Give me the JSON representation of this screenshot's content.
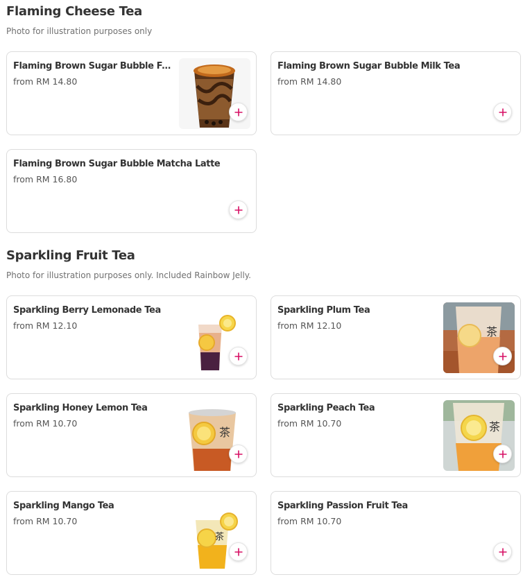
{
  "colors": {
    "accent": "#d70f64",
    "border": "#dcdcdc",
    "text": "#333333",
    "muted": "#707070"
  },
  "sections": [
    {
      "title": "Flaming Cheese Tea",
      "subtitle": "Photo for illustration purposes only",
      "items": [
        {
          "name": "Flaming Brown Sugar Bubble Fresh Milk",
          "price": "from RM 14.80",
          "image": "flaming-brown-sugar-cup"
        },
        {
          "name": "Flaming Brown Sugar Bubble Milk Tea",
          "price": "from RM 14.80",
          "image": ""
        },
        {
          "name": "Flaming Brown Sugar Bubble Matcha Latte",
          "price": "from RM 16.80",
          "image": ""
        }
      ]
    },
    {
      "title": "Sparkling Fruit Tea",
      "subtitle": "Photo for illustration purposes only. Included Rainbow Jelly.",
      "items": [
        {
          "name": "Sparkling Berry Lemonade Tea",
          "price": "from RM 12.10",
          "image": "berry-lemonade-cup"
        },
        {
          "name": "Sparkling Plum Tea",
          "price": "from RM 12.10",
          "image": "plum-tea-photo"
        },
        {
          "name": "Sparkling Honey Lemon Tea",
          "price": "from RM 10.70",
          "image": "honey-lemon-cup"
        },
        {
          "name": "Sparkling Peach Tea",
          "price": "from RM 10.70",
          "image": "peach-tea-photo"
        },
        {
          "name": "Sparkling Mango Tea",
          "price": "from RM 10.70",
          "image": "mango-tea-cup"
        },
        {
          "name": "Sparkling Passion Fruit Tea",
          "price": "from RM 10.70",
          "image": ""
        }
      ]
    }
  ],
  "add_icon": "plus-icon"
}
